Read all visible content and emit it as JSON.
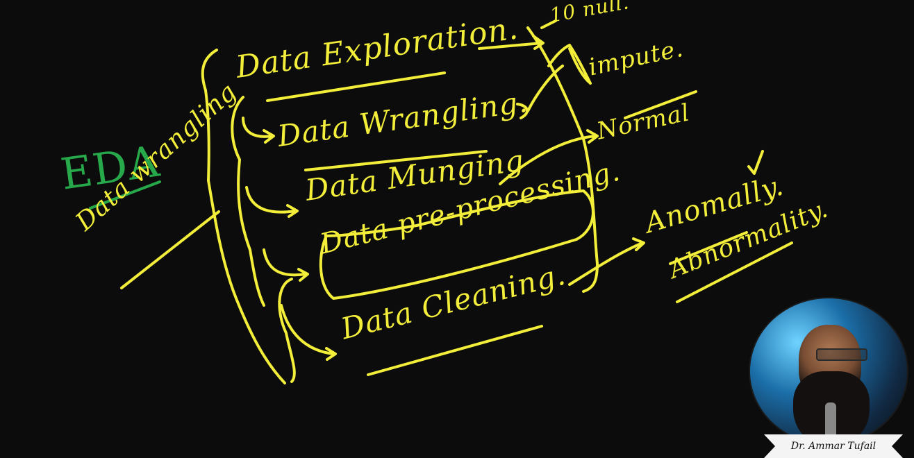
{
  "colors": {
    "chalk": "#f2ee3a",
    "eda": "#27a84a",
    "board": "#0c0c0c"
  },
  "diagram": {
    "eda": "EDA",
    "root": "Data wrangling",
    "items": [
      "Data Exploration.",
      "Data Wrangling.",
      "Data Munging",
      "Data pre-processing.",
      "Data Cleaning."
    ],
    "exploration_branches": [
      "10 null.",
      "impute.",
      "Normal"
    ],
    "cleaning_branches": [
      "Anomally.",
      "Abnormality."
    ]
  },
  "webcam": {
    "name_tag": "Dr. Ammar Tufail"
  }
}
